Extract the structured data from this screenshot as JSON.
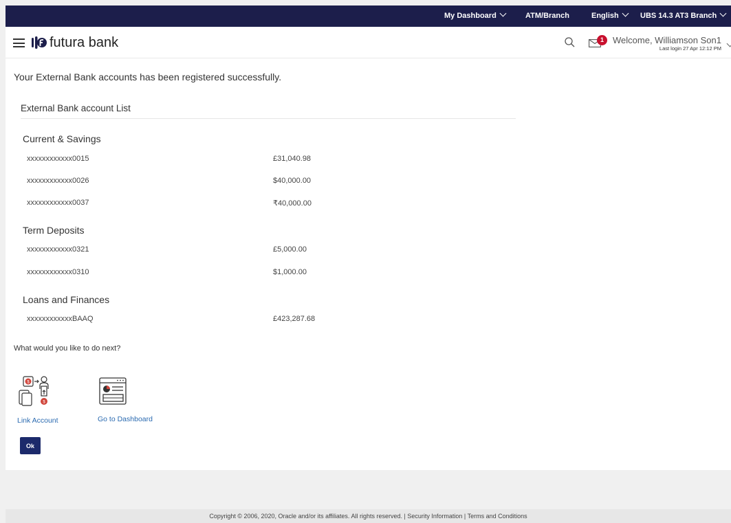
{
  "topbar": {
    "dashboard": "My Dashboard",
    "atm_branch": "ATM/Branch",
    "language": "English",
    "branch": "UBS 14.3 AT3 Branch"
  },
  "header": {
    "brand": "futura bank",
    "mail_count": "1",
    "welcome": "Welcome, Williamson Son1",
    "last_login": "Last login 27 Apr 12:12 PM"
  },
  "main": {
    "success_message": "Your External Bank accounts has been registered successfully.",
    "list_title": "External Bank account List",
    "groups": [
      {
        "name": "Current & Savings",
        "accounts": [
          {
            "number": "xxxxxxxxxxxx0015",
            "balance": "£31,040.98"
          },
          {
            "number": "xxxxxxxxxxxx0026",
            "balance": "$40,000.00"
          },
          {
            "number": "xxxxxxxxxxxx0037",
            "balance": "₹40,000.00"
          }
        ]
      },
      {
        "name": "Term Deposits",
        "accounts": [
          {
            "number": "xxxxxxxxxxxx0321",
            "balance": "£5,000.00"
          },
          {
            "number": "xxxxxxxxxxxx0310",
            "balance": "$1,000.00"
          }
        ]
      },
      {
        "name": "Loans and Finances",
        "accounts": [
          {
            "number": "xxxxxxxxxxxxBAAQ",
            "balance": "£423,287.68"
          }
        ]
      }
    ],
    "next_prompt": "What would you like to do next?",
    "actions": {
      "link_account": "Link Account",
      "go_to_dashboard": "Go to Dashboard"
    },
    "ok_label": "Ok"
  },
  "footer": {
    "copyright": "Copyright © 2006, 2020, Oracle and/or its affiliates. All rights reserved.",
    "sep": "|",
    "security": "Security Information",
    "terms": "Terms and Conditions"
  },
  "colors": {
    "topbar": "#1c1e4b",
    "primary_button": "#1c2a6b",
    "link": "#2a6ab0",
    "badge": "#c8102e"
  }
}
